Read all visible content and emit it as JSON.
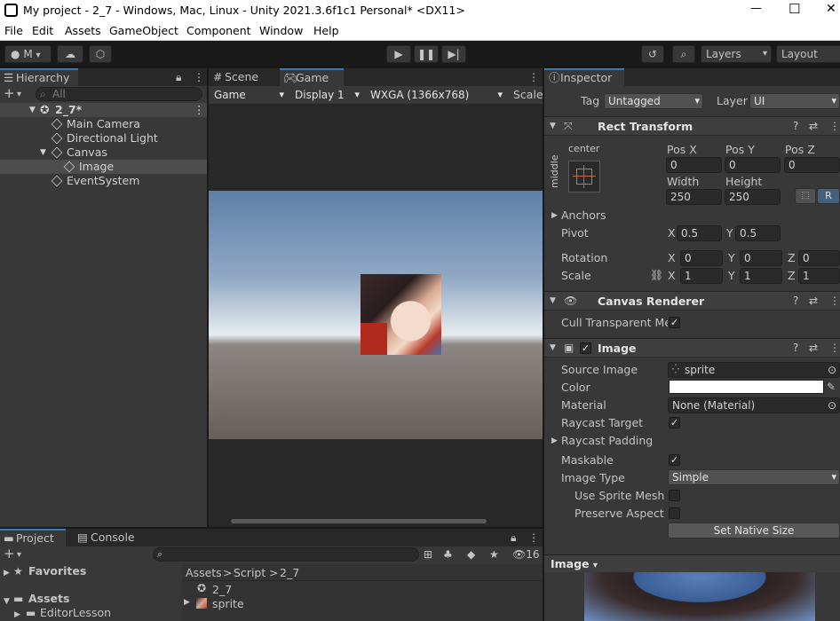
{
  "window": {
    "title": "My project - 2_7 - Windows, Mac, Linux - Unity 2021.3.6f1c1 Personal* <DX11>",
    "minimize": "—",
    "maximize": "☐",
    "close": "✕"
  },
  "menu": [
    "File",
    "Edit",
    "Assets",
    "GameObject",
    "Component",
    "Window",
    "Help"
  ],
  "toolbar": {
    "account_label": "M",
    "layers_label": "Layers",
    "layout_label": "Layout"
  },
  "hierarchy": {
    "tab": "Hierarchy",
    "search_placeholder": "All",
    "scene": "2_7*",
    "items": [
      "Main Camera",
      "Directional Light",
      "Canvas",
      "Image",
      "EventSystem"
    ]
  },
  "game": {
    "tabs": [
      "Scene",
      "Game"
    ],
    "view_mode": "Game",
    "display": "Display 1",
    "resolution": "WXGA (1366x768)",
    "scale_label": "Scale"
  },
  "inspector": {
    "tab": "Inspector",
    "tag_label": "Tag",
    "tag_value": "Untagged",
    "layer_label": "Layer",
    "layer_value": "UI",
    "rect_transform": {
      "title": "Rect Transform",
      "anchor_h": "center",
      "anchor_v": "middle",
      "pos_x_label": "Pos X",
      "pos_y_label": "Pos Y",
      "pos_z_label": "Pos Z",
      "pos_x": "0",
      "pos_y": "0",
      "pos_z": "0",
      "width_label": "Width",
      "height_label": "Height",
      "width": "250",
      "height": "250",
      "r_button": "R",
      "anchors_label": "Anchors",
      "pivot_label": "Pivot",
      "pivot_x": "0.5",
      "pivot_y": "0.5",
      "rotation_label": "Rotation",
      "rot_x": "0",
      "rot_y": "0",
      "rot_z": "0",
      "scale_label": "Scale",
      "scale_x": "1",
      "scale_y": "1",
      "scale_z": "1",
      "x": "X",
      "y": "Y",
      "z": "Z"
    },
    "canvas_renderer": {
      "title": "Canvas Renderer",
      "cull_label": "Cull Transparent Mes"
    },
    "image": {
      "title": "Image",
      "source_label": "Source Image",
      "source_value": "sprite",
      "color_label": "Color",
      "material_label": "Material",
      "material_value": "None (Material)",
      "raycast_target_label": "Raycast Target",
      "raycast_padding_label": "Raycast Padding",
      "maskable_label": "Maskable",
      "image_type_label": "Image Type",
      "image_type_value": "Simple",
      "use_sprite_mesh_label": "Use Sprite Mesh",
      "preserve_aspect_label": "Preserve Aspect",
      "set_native_size": "Set Native Size"
    },
    "preview_label": "Image"
  },
  "project": {
    "tabs": [
      "Project",
      "Console"
    ],
    "hidden_count": "16",
    "favorites": "Favorites",
    "assets": "Assets",
    "editor_lesson": "EditorLesson",
    "breadcrumb": [
      "Assets",
      "Script",
      "2_7"
    ],
    "files": [
      "2_7",
      "sprite"
    ]
  },
  "colors": {
    "accent": "#3a79bb",
    "panel": "#383838",
    "dark": "#191919"
  }
}
